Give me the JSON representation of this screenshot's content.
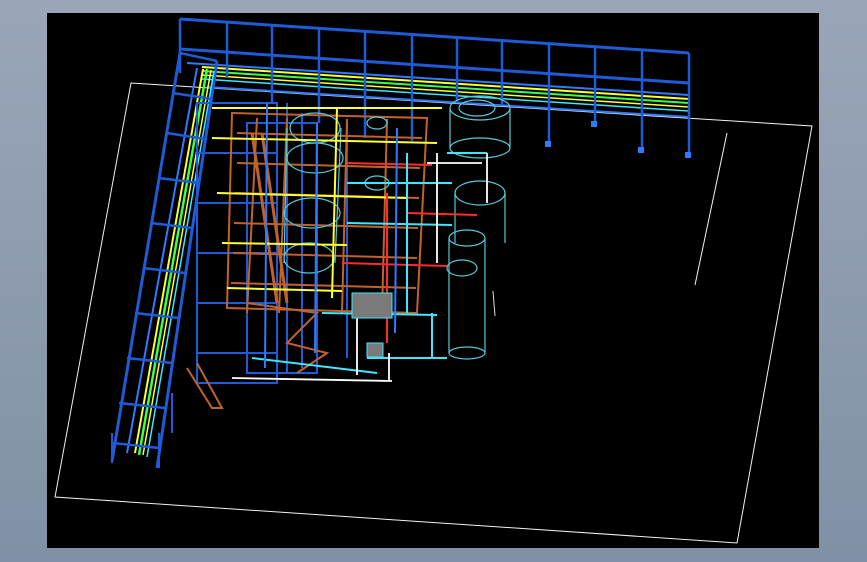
{
  "app": {
    "title": ""
  },
  "viewport": {
    "background": "#000000",
    "frame_color": "#9aa6b8"
  },
  "drawing": {
    "annotation_text": "",
    "colors": {
      "structure": "#1f5bd6",
      "structure_light": "#2f7bff",
      "platform": "#c0622b",
      "pipe_cyan": "#3fe6ff",
      "pipe_yellow": "#ffff33",
      "pipe_red": "#ff2a2a",
      "pipe_white": "#ffffff",
      "pipe_green": "#3cff4a",
      "vessel": "#57c9d8",
      "boundary": "#f2f2f2"
    }
  }
}
